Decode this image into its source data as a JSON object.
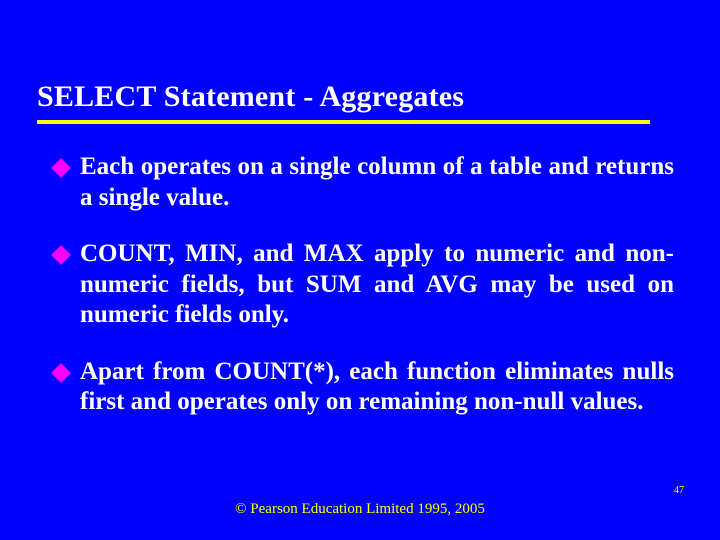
{
  "title": "SELECT Statement - Aggregates",
  "bullets": [
    {
      "text": "Each operates on a single column of a table and returns a single value."
    },
    {
      "text": "COUNT, MIN, and MAX apply to numeric and non-numeric fields, but SUM and AVG may be used on numeric fields only."
    },
    {
      "text": "Apart from COUNT(*), each function eliminates nulls first and operates only on remaining non-null values."
    }
  ],
  "footer": "© Pearson Education Limited 1995, 2005",
  "page_number": "47"
}
